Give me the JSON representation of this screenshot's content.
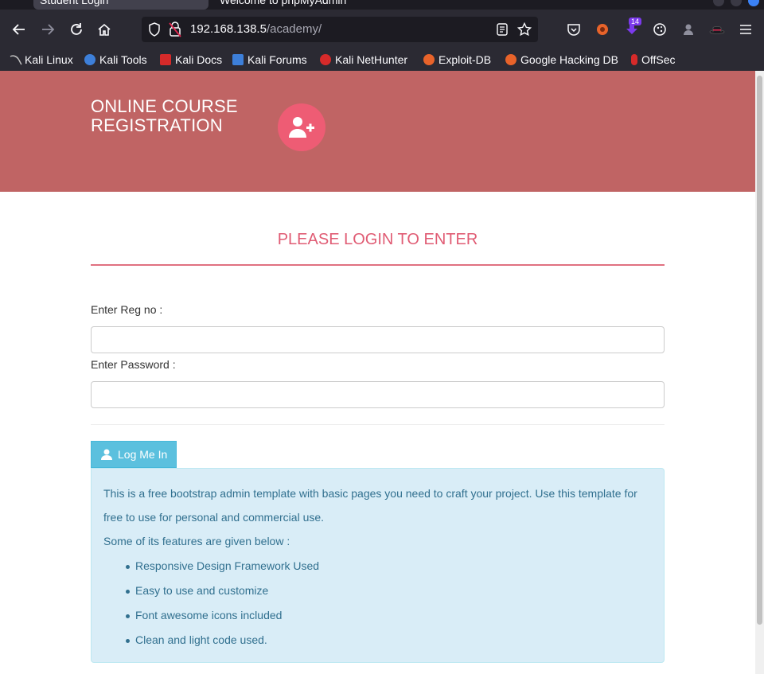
{
  "browser": {
    "tabs": [
      {
        "label": "Student Login"
      },
      {
        "label": "Welcome to phpMyAdmin"
      }
    ],
    "url": {
      "host": "192.168.138.5",
      "path": "/academy/"
    },
    "extension_badge": "14",
    "bookmarks": [
      {
        "label": "Kali Linux",
        "color": "#8a8a8a"
      },
      {
        "label": "Kali Tools",
        "color": "#3d7fd9"
      },
      {
        "label": "Kali Docs",
        "color": "#d62a2a"
      },
      {
        "label": "Kali Forums",
        "color": "#3d7fd9"
      },
      {
        "label": "Kali NetHunter",
        "color": "#d62a2a"
      },
      {
        "label": "Exploit-DB",
        "color": "#e8632a"
      },
      {
        "label": "Google Hacking DB",
        "color": "#e8632a"
      },
      {
        "label": "OffSec",
        "color": "#d62a2a"
      }
    ]
  },
  "site": {
    "title_line1": "ONLINE COURSE",
    "title_line2": "REGISTRATION",
    "logo_icon": "user-plus-icon",
    "header_color": "#c06464",
    "accent_color": "#ee5c74"
  },
  "login": {
    "heading": "PLEASE LOGIN TO ENTER",
    "reg_label": "Enter Reg no :",
    "reg_value": "",
    "password_label": "Enter Password :",
    "password_value": "",
    "button_label": "Log Me In"
  },
  "info": {
    "intro": "This is a free bootstrap admin template with basic pages you need to craft your project. Use this template for free to use for personal and commercial use.",
    "features_heading": "Some of its features are given below :",
    "features": [
      "Responsive Design Framework Used",
      "Easy to use and customize",
      "Font awesome icons included",
      "Clean and light code used."
    ]
  }
}
